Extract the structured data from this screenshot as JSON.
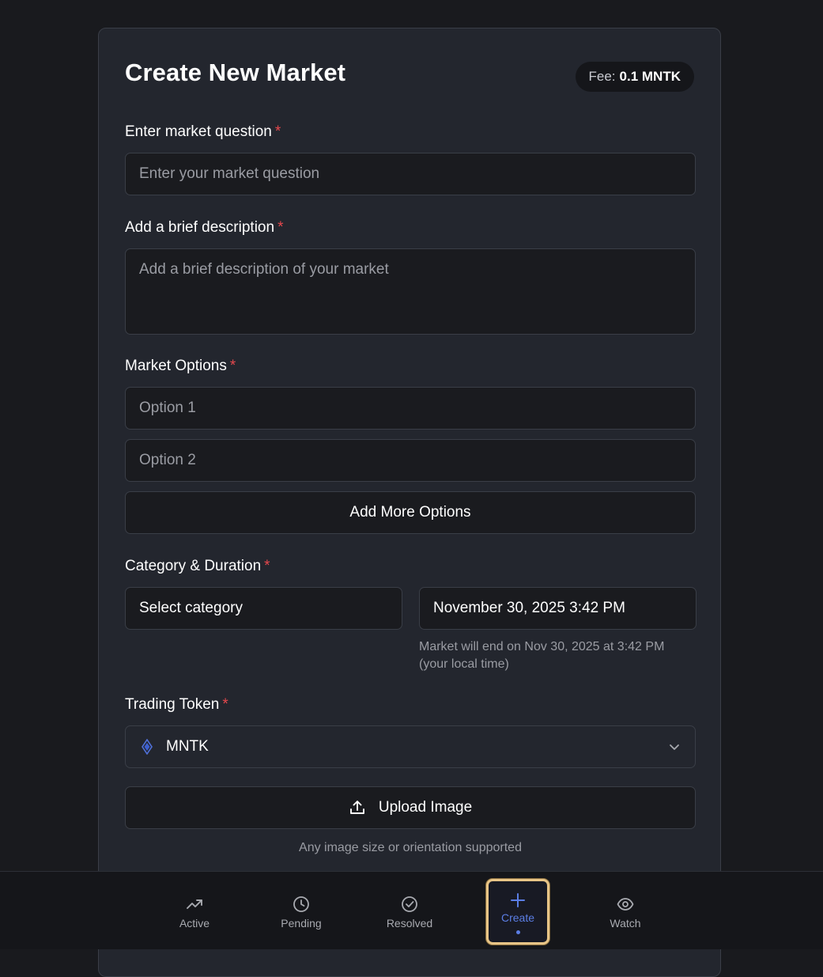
{
  "form": {
    "title": "Create New Market",
    "fee_label": "Fee:",
    "fee_value": "0.1 MNTK",
    "required_mark": "*",
    "question_label": "Enter market question",
    "question_placeholder": "Enter your market question",
    "description_label": "Add a brief description",
    "description_placeholder": "Add a brief description of your market",
    "options_label": "Market Options",
    "option1_placeholder": "Option 1",
    "option2_placeholder": "Option 2",
    "add_options_label": "Add More Options",
    "category_duration_label": "Category & Duration",
    "category_placeholder": "Select category",
    "end_date_value": "November 30, 2025 3:42 PM",
    "end_hint": "Market will end on Nov 30, 2025 at 3:42 PM (your local time)",
    "trading_token_label": "Trading Token",
    "token_value": "MNTK",
    "upload_label": "Upload Image",
    "upload_hint": "Any image size or orientation supported"
  },
  "bottom_nav": {
    "items": [
      {
        "label": "Active",
        "icon": "trending-up-icon"
      },
      {
        "label": "Pending",
        "icon": "clock-icon"
      },
      {
        "label": "Resolved",
        "icon": "check-circle-icon"
      },
      {
        "label": "Create",
        "icon": "plus-icon",
        "active": true
      },
      {
        "label": "Watch",
        "icon": "eye-icon"
      }
    ]
  },
  "colors": {
    "background": "#191a1e",
    "card": "#23262e",
    "required": "#e5484d",
    "accent": "#5b7ee5",
    "highlight_border": "#e8c587"
  }
}
